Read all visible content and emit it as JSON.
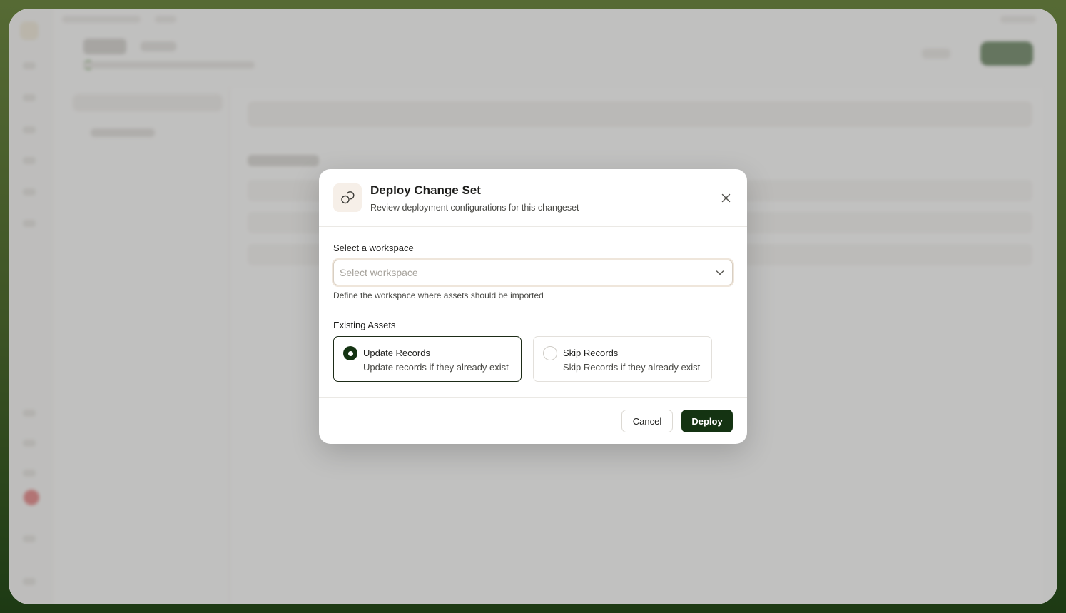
{
  "modal": {
    "title": "Deploy Change Set",
    "subtitle": "Review deployment configurations for this changeset",
    "icon": "link-circles-icon",
    "workspace": {
      "label": "Select a workspace",
      "placeholder": "Select workspace",
      "value": "",
      "helper": "Define the workspace where assets should be imported"
    },
    "existing_assets": {
      "label": "Existing Assets",
      "options": [
        {
          "title": "Update Records",
          "description": "Update records if they already exist",
          "selected": true
        },
        {
          "title": "Skip Records",
          "description": "Skip Records if they already exist",
          "selected": false
        }
      ]
    },
    "buttons": {
      "cancel": "Cancel",
      "deploy": "Deploy"
    }
  },
  "colors": {
    "primary": "#143312",
    "backdrop": "#3f5526",
    "selected_border": "#1d2b17"
  }
}
